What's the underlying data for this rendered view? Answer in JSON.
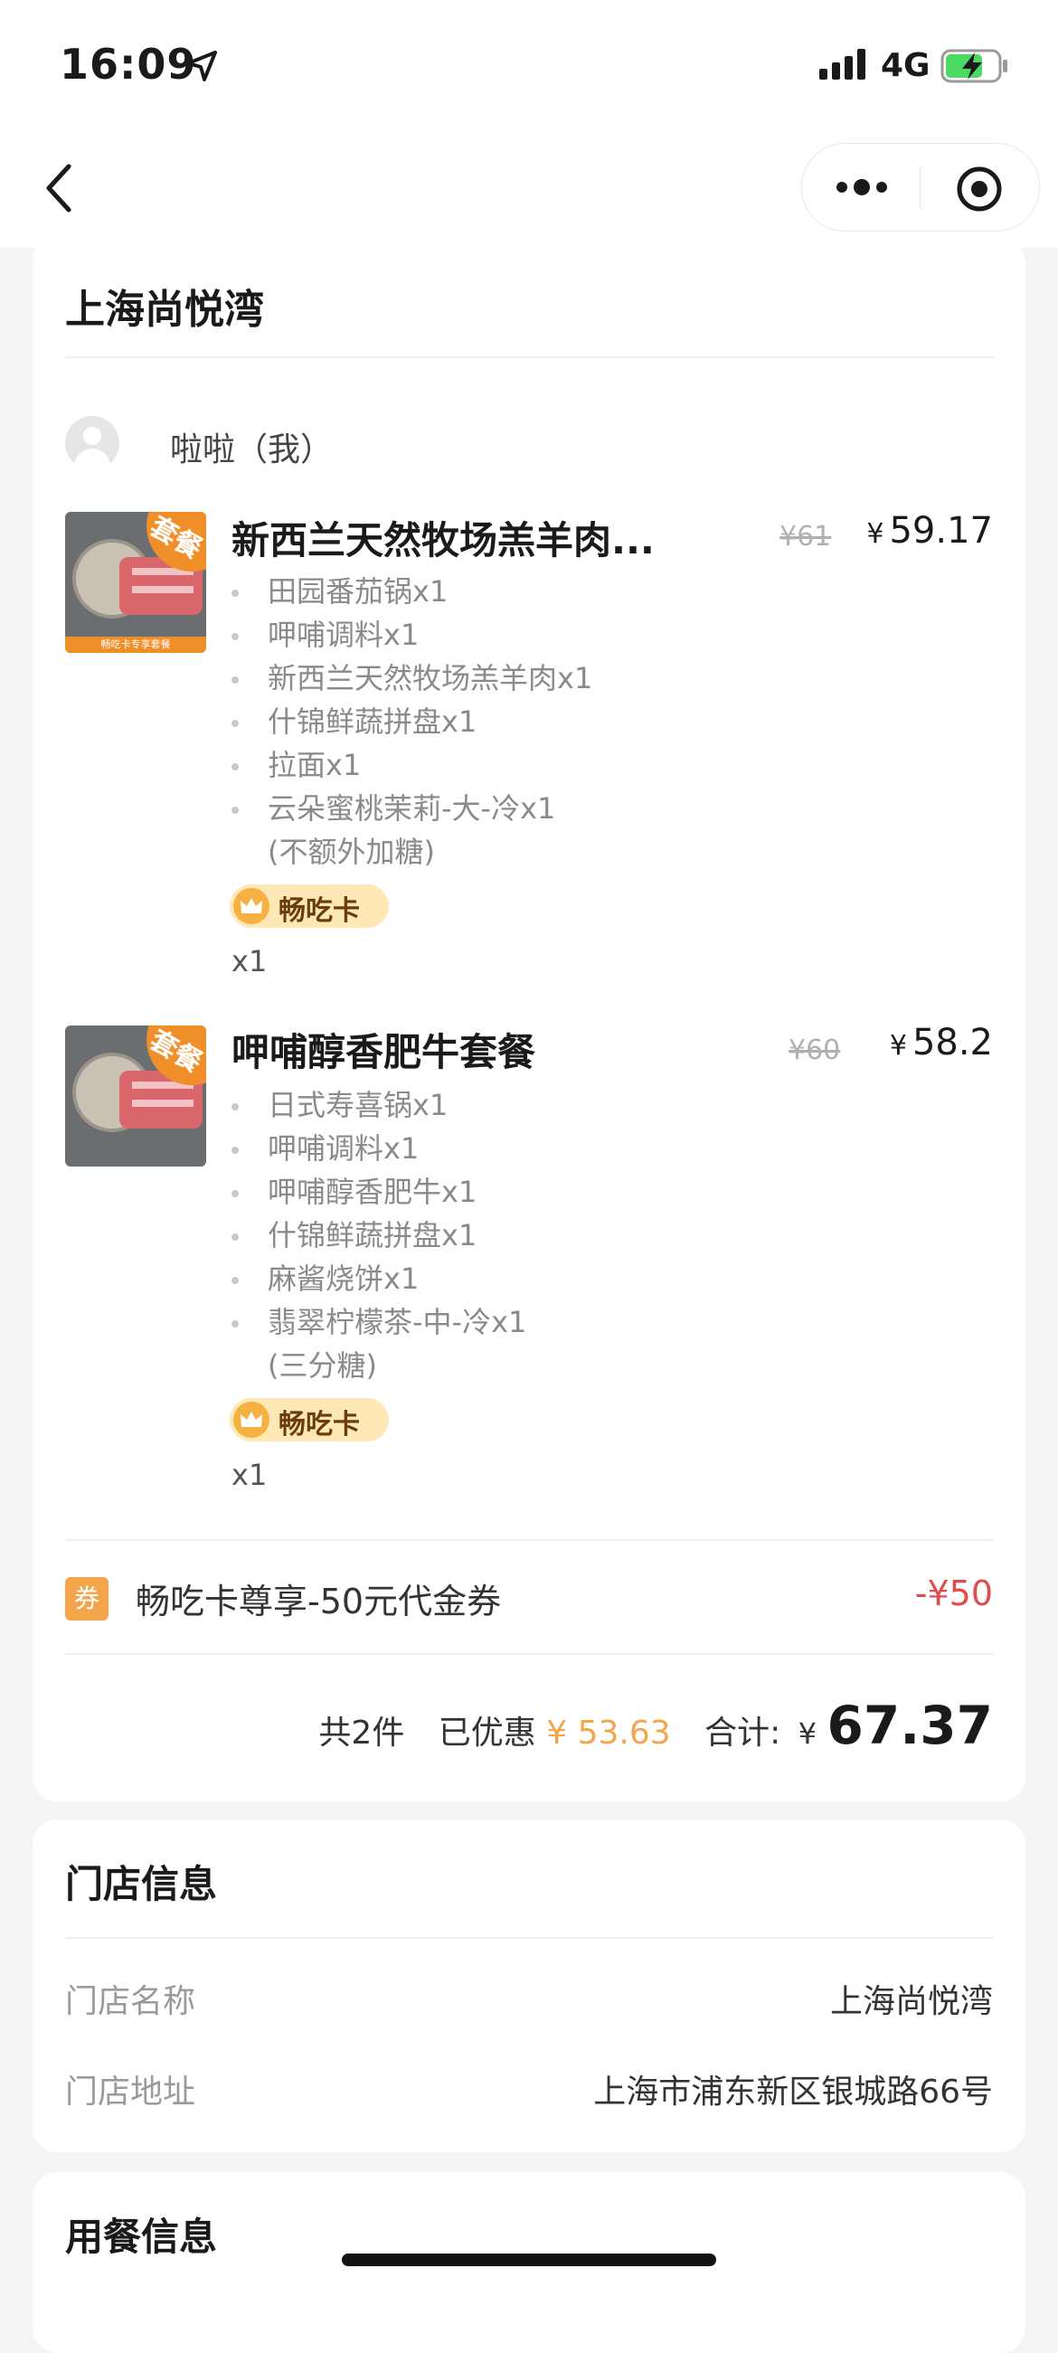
{
  "status_bar": {
    "time": "16:09",
    "network": "4G"
  },
  "store_card": {
    "title": "上海尚悦湾",
    "user": "啦啦（我）",
    "items": [
      {
        "thumb_badge": "套餐",
        "thumb_strip": "畅吃卡专享套餐",
        "name": "新西兰天然牧场羔羊肉...",
        "original_price": "¥61",
        "price_symbol": "¥",
        "price": "59.17",
        "components": [
          "田园番茄锅x1",
          "呷哺调料x1",
          "新西兰天然牧场羔羊肉x1",
          "什锦鲜蔬拼盘x1",
          "拉面x1",
          "云朵蜜桃茉莉-大-冷x1"
        ],
        "note": "(不额外加糖)",
        "badge": "畅吃卡",
        "quantity": "x1"
      },
      {
        "thumb_badge": "套餐",
        "thumb_strip": "",
        "name": "呷哺醇香肥牛套餐",
        "original_price": "¥60",
        "price_symbol": "¥",
        "price": "58.2",
        "components": [
          "日式寿喜锅x1",
          "呷哺调料x1",
          "呷哺醇香肥牛x1",
          "什锦鲜蔬拼盘x1",
          "麻酱烧饼x1",
          "翡翠柠檬茶-中-冷x1"
        ],
        "note": "(三分糖)",
        "badge": "畅吃卡",
        "quantity": "x1"
      }
    ],
    "coupon": {
      "icon": "券",
      "text": "畅吃卡尊享-50元代金券",
      "amount": "-¥50"
    },
    "summary": {
      "count": "共2件",
      "discount_label": "已优惠",
      "discount": "¥ 53.63",
      "total_label": "合计:",
      "total_symbol": "¥",
      "total": "67.37"
    }
  },
  "store_info": {
    "title": "门店信息",
    "name_label": "门店名称",
    "name_value": "上海尚悦湾",
    "address_label": "门店地址",
    "address_value": "上海市浦东新区银城路66号"
  },
  "dining_info": {
    "title": "用餐信息"
  },
  "colors": {
    "accent_orange": "#f2a54a",
    "discount_red": "#e04b4b",
    "battery_green": "#4cd964"
  },
  "icons": [
    "location-arrow-icon",
    "signal-icon",
    "battery-charging-icon",
    "back-chevron-icon",
    "more-dots-icon",
    "target-icon",
    "crown-icon",
    "coupon-icon"
  ]
}
